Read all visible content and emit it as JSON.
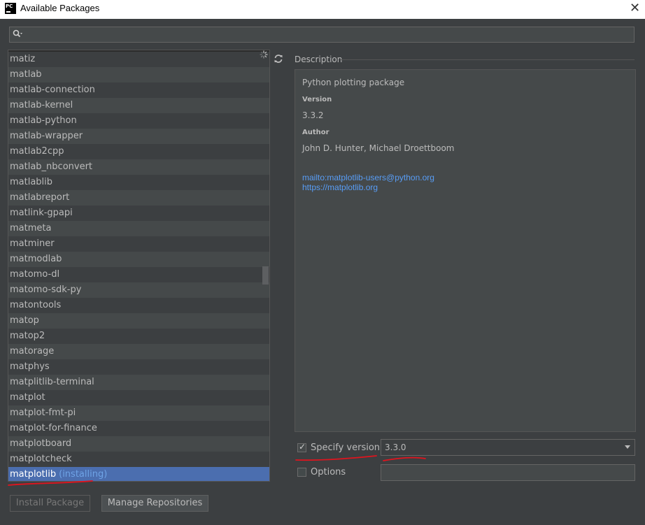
{
  "window": {
    "title": "Available Packages",
    "app_icon": "pc-icon",
    "close_glyph": "✕"
  },
  "search": {
    "value": "",
    "placeholder": ""
  },
  "packages": [
    {
      "name": "matiz"
    },
    {
      "name": "matlab"
    },
    {
      "name": "matlab-connection"
    },
    {
      "name": "matlab-kernel"
    },
    {
      "name": "matlab-python"
    },
    {
      "name": "matlab-wrapper"
    },
    {
      "name": "matlab2cpp"
    },
    {
      "name": "matlab_nbconvert"
    },
    {
      "name": "matlablib"
    },
    {
      "name": "matlabreport"
    },
    {
      "name": "matlink-gpapi"
    },
    {
      "name": "matmeta"
    },
    {
      "name": "matminer"
    },
    {
      "name": "matmodlab"
    },
    {
      "name": "matomo-dl"
    },
    {
      "name": "matomo-sdk-py"
    },
    {
      "name": "matontools"
    },
    {
      "name": "matop"
    },
    {
      "name": "matop2"
    },
    {
      "name": "matorage"
    },
    {
      "name": "matphys"
    },
    {
      "name": "matplitlib-terminal"
    },
    {
      "name": "matplot"
    },
    {
      "name": "matplot-fmt-pi"
    },
    {
      "name": "matplot-for-finance"
    },
    {
      "name": "matplotboard"
    },
    {
      "name": "matplotcheck"
    },
    {
      "name": "matplotlib",
      "status": "(installing)",
      "selected": true
    }
  ],
  "description": {
    "section_label": "Description",
    "summary": "Python plotting package",
    "version_heading": "Version",
    "version": "3.3.2",
    "author_heading": "Author",
    "author": "John D. Hunter, Michael Droettboom",
    "mailto": "mailto:matplotlib-users@python.org",
    "url": "https://matplotlib.org"
  },
  "specify_version": {
    "label": "Specify version",
    "checked": true,
    "selected_value": "3.3.0"
  },
  "options": {
    "label": "Options",
    "checked": false,
    "value": ""
  },
  "buttons": {
    "install": "Install Package",
    "manage": "Manage Repositories"
  },
  "colors": {
    "accent_selection": "#4b6eaf",
    "link": "#589df6",
    "annotation": "#e0141e"
  }
}
